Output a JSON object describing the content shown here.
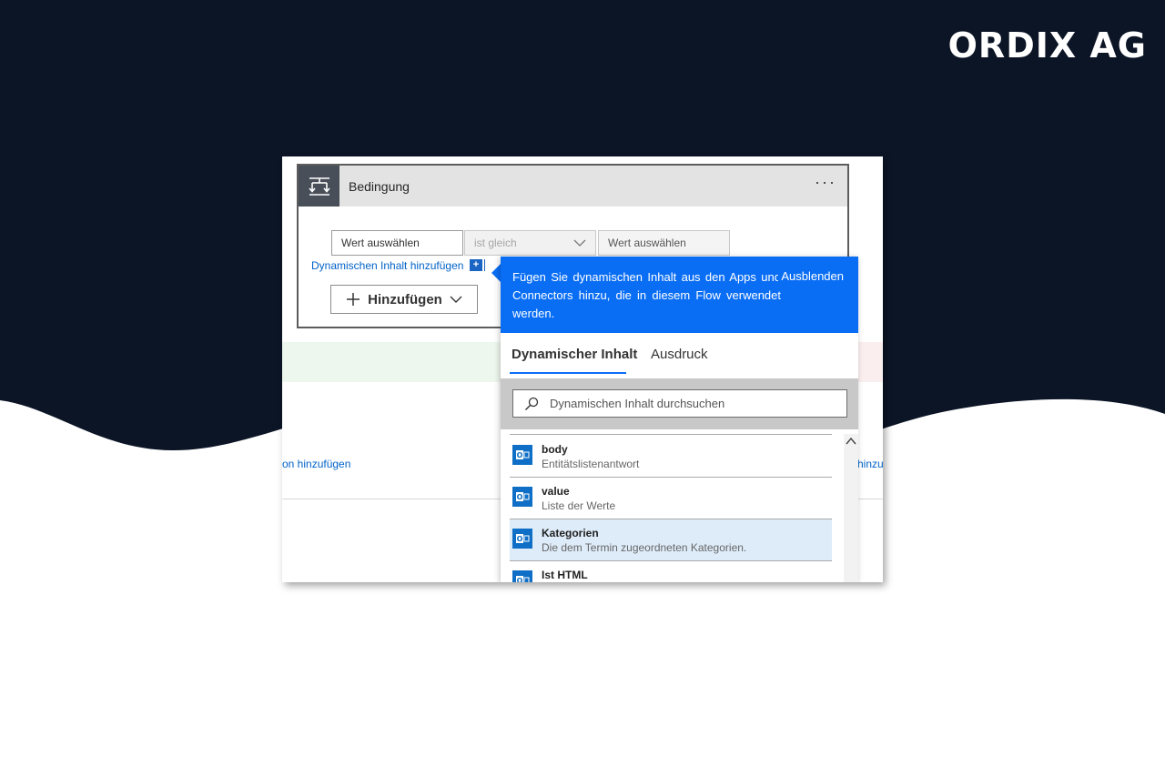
{
  "brand": {
    "logo_text": "ORDIX AG"
  },
  "colors": {
    "navy": "#0c1526",
    "accent": "#0a6ef5",
    "link": "#0062c8"
  },
  "condition": {
    "title": "Bedingung",
    "more": "···",
    "left_value_placeholder": "Wert auswählen",
    "operator": "ist gleich",
    "right_value_placeholder": "Wert auswählen",
    "dynamic_link": "Dynamischen Inhalt hinzufügen",
    "dynamic_plus": "+",
    "add_button": "Hinzufügen"
  },
  "background_links": {
    "left": "on hinzufügen",
    "right": "hinzu"
  },
  "dynamic_panel": {
    "info_text": "Fügen Sie dynamischen Inhalt aus den Apps und Connectors hinzu, die in diesem Flow verwendet werden.",
    "hide_label": "Ausblenden",
    "tabs": [
      {
        "label": "Dynamischer Inhalt",
        "active": true
      },
      {
        "label": "Ausdruck",
        "active": false
      }
    ],
    "search_placeholder": "Dynamischen Inhalt durchsuchen",
    "items": [
      {
        "title": "body",
        "desc": "Entitätslistenantwort",
        "icon": "outlook-icon"
      },
      {
        "title": "value",
        "desc": "Liste der Werte",
        "icon": "outlook-icon"
      },
      {
        "title": "Kategorien",
        "desc": "Die dem Termin zugeordneten Kategorien.",
        "icon": "outlook-icon",
        "selected": true
      },
      {
        "title": "Ist HTML",
        "desc": "",
        "icon": "outlook-icon"
      }
    ]
  }
}
